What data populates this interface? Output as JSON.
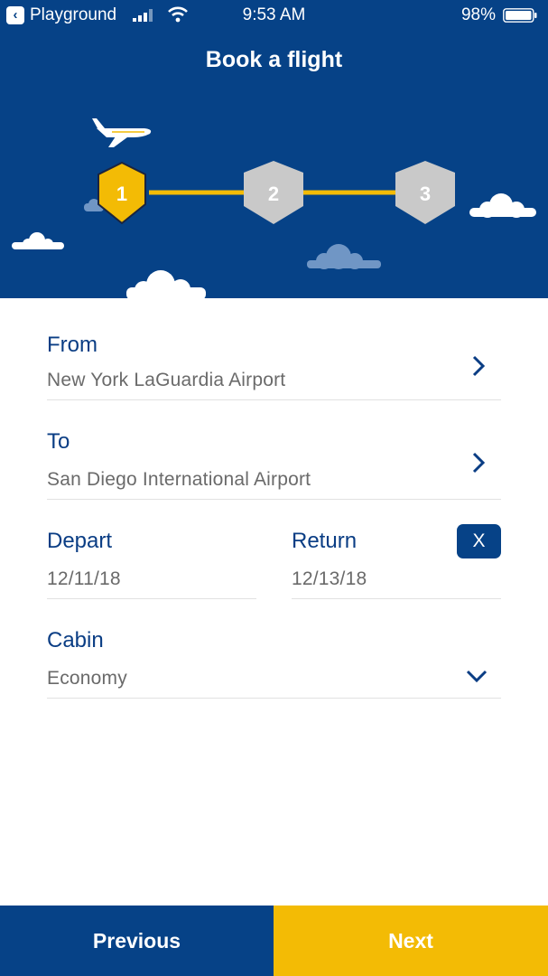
{
  "status_bar": {
    "app_name": "Playground",
    "time": "9:53 AM",
    "battery_percent": "98%"
  },
  "header": {
    "title": "Book a flight",
    "steps": [
      {
        "label": "1",
        "state": "active"
      },
      {
        "label": "2",
        "state": "inactive"
      },
      {
        "label": "3",
        "state": "inactive"
      }
    ]
  },
  "form": {
    "from": {
      "label": "From",
      "value": "New York LaGuardia Airport"
    },
    "to": {
      "label": "To",
      "value": "San Diego International Airport"
    },
    "depart": {
      "label": "Depart",
      "value": "12/11/18"
    },
    "return": {
      "label": "Return",
      "value": "12/13/18",
      "clear_label": "X"
    },
    "cabin": {
      "label": "Cabin",
      "value": "Economy"
    }
  },
  "footer": {
    "previous_label": "Previous",
    "next_label": "Next"
  },
  "colors": {
    "primary": "#064287",
    "accent": "#f3bb05",
    "inactive_step": "#c9c9c9",
    "label_text": "#0a3d84",
    "value_text": "#6a6a6a"
  }
}
